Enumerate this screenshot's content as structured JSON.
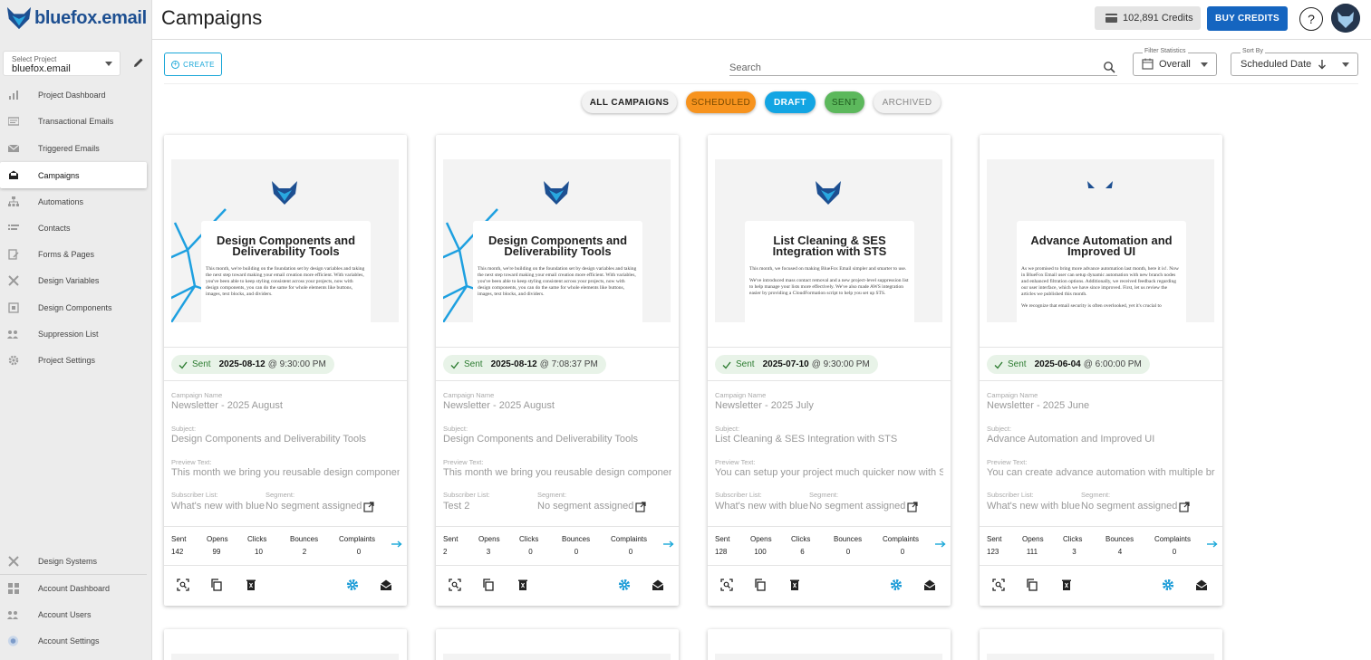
{
  "app": {
    "logo_text": "bluefox.email"
  },
  "sidebar": {
    "project_label": "Select Project",
    "project_value": "bluefox.email",
    "items": [
      {
        "label": "Project Dashboard",
        "icon": "chart-icon"
      },
      {
        "label": "Transactional Emails",
        "icon": "email-lines-icon"
      },
      {
        "label": "Triggered Emails",
        "icon": "envelope-icon"
      },
      {
        "label": "Campaigns",
        "icon": "inbox-icon"
      },
      {
        "label": "Automations",
        "icon": "sitemap-icon"
      },
      {
        "label": "Contacts",
        "icon": "list-icon"
      },
      {
        "label": "Forms & Pages",
        "icon": "form-icon"
      },
      {
        "label": "Design Variables",
        "icon": "tools-icon"
      },
      {
        "label": "Design Components",
        "icon": "component-icon"
      },
      {
        "label": "Suppression List",
        "icon": "people-icon"
      },
      {
        "label": "Project Settings",
        "icon": "gear-icon"
      }
    ],
    "bottom_items": [
      {
        "label": "Design Systems",
        "icon": "tools-icon"
      },
      {
        "label": "Account Dashboard",
        "icon": "grid-icon"
      },
      {
        "label": "Account Users",
        "icon": "people-icon"
      },
      {
        "label": "Account Settings",
        "icon": "globe-icon"
      }
    ]
  },
  "header": {
    "title": "Campaigns",
    "credits": "102,891 Credits",
    "buy_credits": "BUY CREDITS",
    "help": "?"
  },
  "toolbar": {
    "create_label": "CREATE",
    "search_placeholder": "Search",
    "filter_label": "Filter Statistics",
    "filter_value": "Overall",
    "sort_label": "Sort By",
    "sort_value": "Scheduled Date"
  },
  "filters": {
    "all": "ALL CAMPAIGNS",
    "scheduled": "SCHEDULED",
    "draft": "DRAFT",
    "sent": "SENT",
    "archived": "ARCHIVED"
  },
  "labels": {
    "campaign_name": "Campaign Name",
    "subject": "Subject:",
    "preview_text": "Preview Text:",
    "subscriber_list": "Subscriber List:",
    "segment": "Segment:",
    "sent": "Sent",
    "opens": "Opens",
    "clicks": "Clicks",
    "bounces": "Bounces",
    "complaints": "Complaints"
  },
  "colors": {
    "accent": "#19a7d8",
    "primary": "#1565c0",
    "scheduled": "#f7931e",
    "draft": "#13a5e3",
    "sent": "#5cb85c"
  },
  "cards": [
    {
      "preview_title": "Design Components and Deliverability Tools",
      "preview_body": "This month, we're building on the foundation set by design variables and taking the next step toward making your email creation more efficient. With variables, you've been able to keep styling consistent across your projects, now with design components, you can do the same for whole elements like buttons, images, text blocks, and dividers.",
      "preview_body2": "",
      "status": "Sent",
      "date": "2025-08-12",
      "time": "@ 9:30:00 PM",
      "name": "Newsletter - 2025 August",
      "subject": "Design Components and Deliverability Tools",
      "preview_text": "This month we bring you reusable design components",
      "list": "What's new with bluefox.email",
      "segment": "No segment assigned",
      "stats": {
        "sent": "142",
        "opens": "99",
        "clicks": "10",
        "bounces": "2",
        "complaints": "0"
      }
    },
    {
      "preview_title": "Design Components and Deliverability Tools",
      "preview_body": "This month, we're building on the foundation set by design variables and taking the next step toward making your email creation more efficient. With variables, you've been able to keep styling consistent across your projects, now with design components, you can do the same for whole elements like buttons, images, text blocks, and dividers.",
      "preview_body2": "",
      "status": "Sent",
      "date": "2025-08-12",
      "time": "@ 7:08:37 PM",
      "name": "Newsletter - 2025 August",
      "subject": "Design Components and Deliverability Tools",
      "preview_text": "This month we bring you reusable design components",
      "list": "Test 2",
      "segment": "No segment assigned",
      "stats": {
        "sent": "2",
        "opens": "3",
        "clicks": "0",
        "bounces": "0",
        "complaints": "0"
      }
    },
    {
      "preview_title": "List Cleaning & SES Integration with STS",
      "preview_body": "This month, we focused on making BlueFox Email simpler and smarter to use.",
      "preview_body2": "We've introduced mass contact removal and a new project-level suppression list to help manage your lists more effectively. We've also made AWS integration easier by providing a CloudFormation script to help you set up STS.",
      "status": "Sent",
      "date": "2025-07-10",
      "time": "@ 9:30:00 PM",
      "name": "Newsletter - 2025 July",
      "subject": "List Cleaning & SES Integration with STS",
      "preview_text": "You can setup your project much quicker now with STS",
      "list": "What's new with bluefox.email",
      "segment": "No segment assigned",
      "stats": {
        "sent": "128",
        "opens": "100",
        "clicks": "6",
        "bounces": "0",
        "complaints": "0"
      }
    },
    {
      "preview_title": "Advance Automation and Improved UI",
      "preview_body": "As we promised to bring more advance automation last month, here it is!. Now in BlueFox Email user can setup dynamic automation with new branch nodes and enhanced filtration options. Additionally, we received feedback regarding our user interface, which we have since improved. First, let us review the articles we published this month.",
      "preview_body2": "We recognize that email security is often overlooked, yet it's crucial to",
      "status": "Sent",
      "date": "2025-06-04",
      "time": "@ 6:00:00 PM",
      "name": "Newsletter - 2025 June",
      "subject": "Advance Automation and Improved UI",
      "preview_text": "You can create advance automation with multiple branches",
      "list": "What's new with bluefox.email",
      "segment": "No segment assigned",
      "stats": {
        "sent": "123",
        "opens": "111",
        "clicks": "3",
        "bounces": "4",
        "complaints": "0"
      }
    }
  ]
}
